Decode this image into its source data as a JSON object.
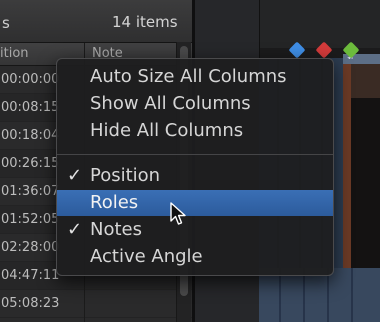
{
  "browser": {
    "header_edge": "s",
    "items_count": "14 items",
    "columns": [
      "ition",
      "Note"
    ],
    "rows": [
      "00:00:00",
      "00:08:15",
      "00:18:04",
      "00:26:15",
      "01:36:07",
      "01:52:05",
      "02:28:00",
      "04:47:11",
      "05:08:23"
    ]
  },
  "menu": {
    "items": [
      {
        "label": "Auto Size All Columns",
        "checked": false,
        "highlighted": false
      },
      {
        "label": "Show All Columns",
        "checked": false,
        "highlighted": false
      },
      {
        "label": "Hide All Columns",
        "checked": false,
        "highlighted": false
      },
      {
        "label": "Position",
        "checked": true,
        "highlighted": false
      },
      {
        "label": "Roles",
        "checked": false,
        "highlighted": true
      },
      {
        "label": "Notes",
        "checked": true,
        "highlighted": false
      },
      {
        "label": "Active Angle",
        "checked": false,
        "highlighted": false
      }
    ],
    "checkmark": "✓"
  },
  "markers": {
    "colors": [
      "#3f8ee6",
      "#d43b3b",
      "#6cbb3c"
    ]
  }
}
